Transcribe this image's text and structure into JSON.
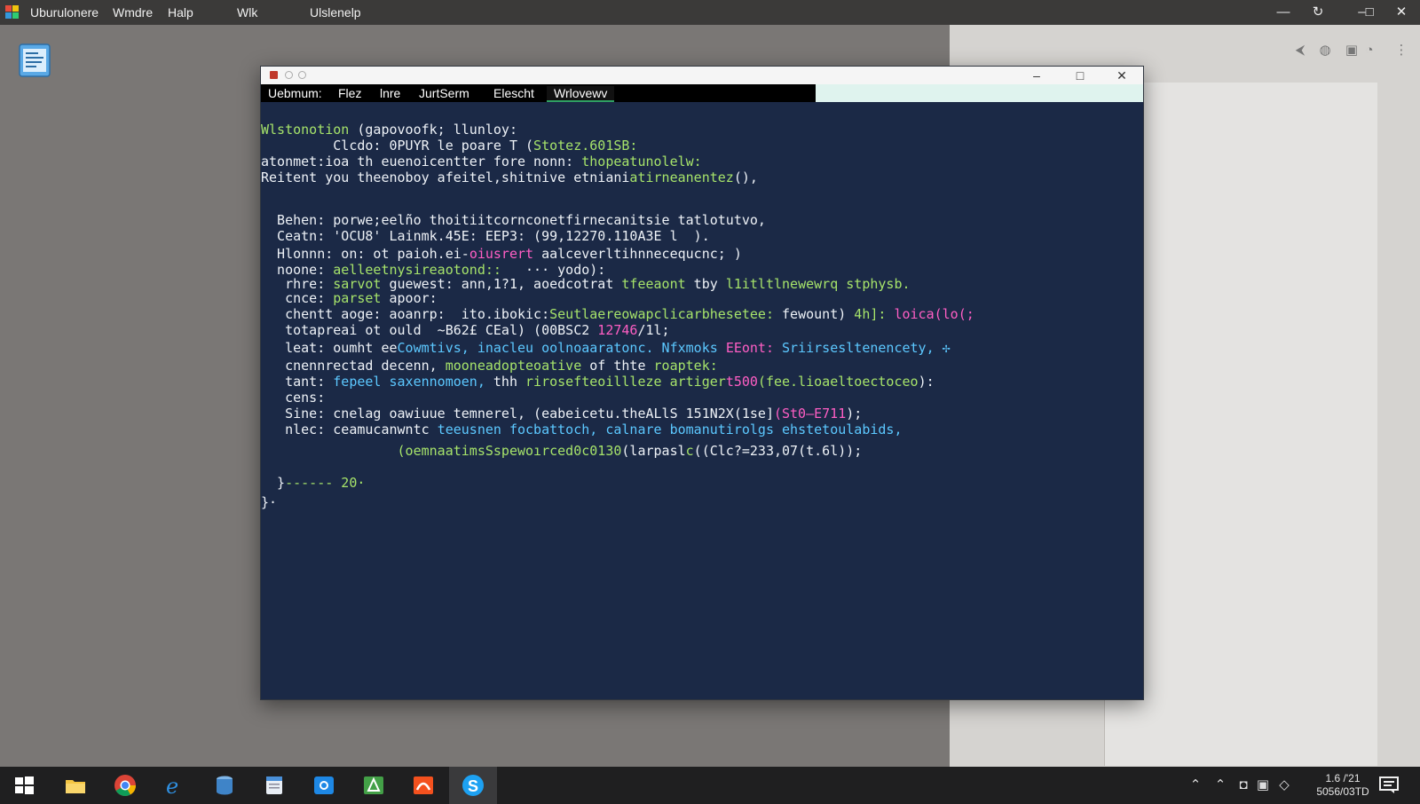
{
  "topbar": {
    "menu": [
      "Uburulonere",
      "Wmdre",
      "Halp",
      "Wlk",
      "Ulslenelp"
    ],
    "controls": {
      "minimize": "—",
      "refresh": "↻",
      "restore": "–□",
      "close": "✕"
    }
  },
  "terminal_window": {
    "menu": [
      "Uebmum:",
      "Flez",
      "lnre",
      "JurtSerm",
      "Elescht",
      "Wrlovewv"
    ],
    "active_menu_index": 5,
    "controls": {
      "minimize": "–",
      "maximize": "□",
      "close": "✕"
    },
    "lines": [
      [
        {
          "t": "Wlstonotion",
          "c": "green"
        },
        {
          "t": " (gapovoofk; llunloy:"
        }
      ],
      [
        {
          "t": "         Clcdo: 0PUYR le poare T ("
        },
        {
          "t": "Stotez.601SB:",
          "c": "green"
        }
      ],
      [
        {
          "t": "atonmet:ioa th euenoicentter fore nonn: "
        },
        {
          "t": "thopeatunolelw:",
          "c": "green"
        }
      ],
      [
        {
          "t": "Reitent you theenoboy afeitel,shitnive etniani"
        },
        {
          "t": "atirneanentez",
          "c": "green"
        },
        {
          "t": "(),"
        }
      ],
      [
        {
          "t": "  Behen: porwe;eelño thoitiitcornconetfirnecanitsie tatlotutvo,"
        }
      ],
      [
        {
          "t": "  Ceatn: 'OCU8' Lainmk.45E: EEP3: (99,12270.110A3E l  )."
        }
      ],
      [
        {
          "t": "  Hlonnn: on: ot paioh.ei-"
        },
        {
          "t": "oiusrert",
          "c": "pink"
        },
        {
          "t": " aalceverltihnnecequcnc; )"
        }
      ],
      [
        {
          "t": "  noone: "
        },
        {
          "t": "aelleetnysireaotond::",
          "c": "green"
        },
        {
          "t": "   ··· yodo):"
        }
      ],
      [
        {
          "t": "   rhre: "
        },
        {
          "t": "sarvot",
          "c": "green"
        },
        {
          "t": " guewest: ann,1?1, aoedcotrat "
        },
        {
          "t": "tfeeaont",
          "c": "green"
        },
        {
          "t": " tby "
        },
        {
          "t": "l1itltlnewewrq stphysb.",
          "c": "green"
        }
      ],
      [
        {
          "t": "   cnce: "
        },
        {
          "t": "parset",
          "c": "green"
        },
        {
          "t": " apoor:"
        }
      ],
      [
        {
          "t": "   chentt aoge: aoanrp:  ito.ibokic:"
        },
        {
          "t": "Seutlaereowapclicarbhesetee:",
          "c": "green"
        },
        {
          "t": " fewount) "
        },
        {
          "t": "4h]:",
          "c": "green"
        },
        {
          "t": " "
        },
        {
          "t": "loica(lo(;",
          "c": "pink"
        }
      ],
      [
        {
          "t": "   totapreai ot ould  ~B62£ CEal) (00BSC2 "
        },
        {
          "t": "12746",
          "c": "pink"
        },
        {
          "t": "/1l;"
        }
      ],
      [
        {
          "t": "   leat: oumht ee"
        },
        {
          "t": "Cowmtivs,",
          "c": "cyan"
        },
        {
          "t": " "
        },
        {
          "t": "inacleu oolnoaaratonc. Nfxmoks",
          "c": "cyan"
        },
        {
          "t": " "
        },
        {
          "t": "EEont:",
          "c": "pink"
        },
        {
          "t": " "
        },
        {
          "t": "Sriirsesltenencety, ✢",
          "c": "cyan"
        }
      ],
      [
        {
          "t": "   cnennrectad decenn, "
        },
        {
          "t": "mooneadopteoative",
          "c": "green"
        },
        {
          "t": " of thte "
        },
        {
          "t": "roaptek:",
          "c": "green"
        }
      ],
      [
        {
          "t": "   tant: "
        },
        {
          "t": "fepeel saxennomoen,",
          "c": "cyan"
        },
        {
          "t": " thh "
        },
        {
          "t": "rirosefteoillleze",
          "c": "green"
        },
        {
          "t": " "
        },
        {
          "t": "artiger",
          "c": "green"
        },
        {
          "t": "t500",
          "c": "pink"
        },
        {
          "t": "(fee.lioaeltoectoceo",
          "c": "green"
        },
        {
          "t": "):"
        }
      ],
      [
        {
          "t": "   cens:"
        }
      ],
      [
        {
          "t": "   Sine: cnelag oawiuue temnerel, (eabeicetu.theALlS 151N2X(1se]"
        },
        {
          "t": "(St0–E711",
          "c": "pink"
        },
        {
          "t": ");"
        }
      ],
      [
        {
          "t": "   nlec: ceamucanwntc "
        },
        {
          "t": "teeusnen focbattoch, calnare bomanutirolgs ehstetoulabids,",
          "c": "cyan"
        }
      ],
      [
        {
          "t": "                 (oemnaatimsSspewo",
          "c": "green"
        },
        {
          "t": "ırced0c0130",
          "c": "green"
        },
        {
          "t": "(larpasl"
        },
        {
          "t": "c",
          "c": "green"
        },
        {
          "t": "((Clc?=233,07(t.6l));"
        }
      ],
      [
        {
          "t": "  }",
          "c": ""
        },
        {
          "t": "------ 20·",
          "c": "green"
        }
      ],
      [
        {
          "t": "}·"
        }
      ]
    ]
  },
  "taskbar": {
    "clock_time": "1.6 /'21",
    "clock_date": "5056/03TD"
  }
}
